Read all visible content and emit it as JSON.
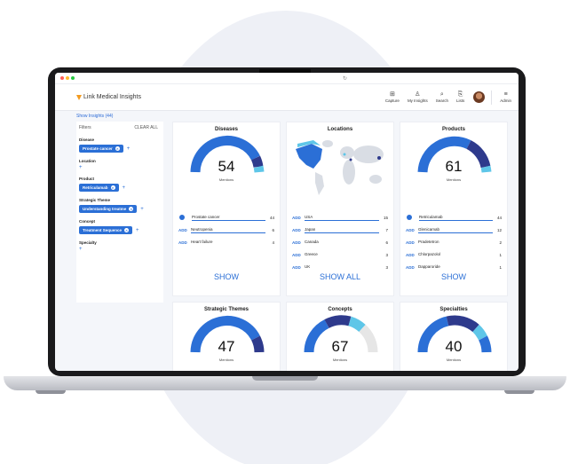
{
  "browser": {
    "reload": "↻"
  },
  "app": {
    "brand": "Link Medical Insights",
    "nav": [
      {
        "label": "Capture",
        "icon": "capture-icon",
        "glyph": "⊞"
      },
      {
        "label": "My Insights",
        "icon": "insights-icon",
        "glyph": "♙"
      },
      {
        "label": "Search",
        "icon": "search-icon",
        "glyph": "⌕"
      },
      {
        "label": "Lists",
        "icon": "lists-icon",
        "glyph": "⎘"
      },
      {
        "label": "Admin",
        "icon": "menu-icon",
        "glyph": "≡"
      }
    ],
    "show_insights": "Show Insights (44)"
  },
  "filters": {
    "title": "Filters",
    "clear": "CLEAR ALL",
    "groups": [
      {
        "label": "Disease",
        "chip": "Prostate cancer"
      },
      {
        "label": "Location",
        "chip": ""
      },
      {
        "label": "Product",
        "chip": "Retriculamab"
      },
      {
        "label": "Strategic Theme",
        "chip": "Understanding treatme"
      },
      {
        "label": "Concept",
        "chip": "Treatment Sequence"
      },
      {
        "label": "Specialty",
        "chip": ""
      }
    ],
    "add": "+"
  },
  "cards": {
    "diseases": {
      "title": "Diseases",
      "count": "54",
      "sub": "Mentions",
      "rows": [
        {
          "prefix": "",
          "name": "Prostate cancer",
          "count": "44"
        },
        {
          "prefix": "ADD",
          "name": "Neutropenia",
          "count": "6"
        },
        {
          "prefix": "ADD",
          "name": "Heart failure",
          "count": "4"
        }
      ],
      "show": "SHOW"
    },
    "locations": {
      "title": "Locations",
      "rows": [
        {
          "prefix": "ADD",
          "name": "USA",
          "count": "15"
        },
        {
          "prefix": "ADD",
          "name": "Japan",
          "count": "7"
        },
        {
          "prefix": "ADD",
          "name": "Canada",
          "count": "6"
        },
        {
          "prefix": "ADD",
          "name": "Greece",
          "count": "3"
        },
        {
          "prefix": "ADD",
          "name": "UK",
          "count": "3"
        }
      ],
      "show": "SHOW ALL"
    },
    "products": {
      "title": "Products",
      "count": "61",
      "sub": "Mentions",
      "rows": [
        {
          "prefix": "",
          "name": "Retriculamab",
          "count": "44"
        },
        {
          "prefix": "ADD",
          "name": "Glenicamab",
          "count": "12"
        },
        {
          "prefix": "ADD",
          "name": "Pradetetron",
          "count": "2"
        },
        {
          "prefix": "ADD",
          "name": "Chlorpazolol",
          "count": "1"
        },
        {
          "prefix": "ADD",
          "name": "Dapparoride",
          "count": "1"
        }
      ],
      "show": "SHOW"
    },
    "themes": {
      "title": "Strategic Themes",
      "count": "47",
      "sub": "Mentions"
    },
    "concepts": {
      "title": "Concepts",
      "count": "67",
      "sub": "Mentions"
    },
    "specialties": {
      "title": "Specialties",
      "count": "40",
      "sub": "Mentions"
    }
  },
  "colors": {
    "primary": "#2b6fd6",
    "dark": "#2e3a8c",
    "light": "#5ec6e8",
    "grey": "#e6e6e6",
    "brand_orange": "#f29a1f"
  }
}
